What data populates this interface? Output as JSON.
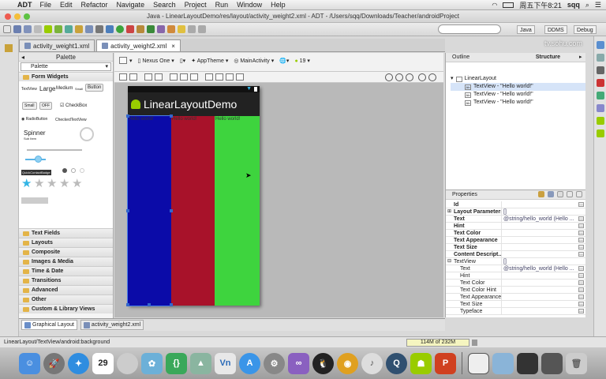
{
  "menubar": {
    "app": "ADT",
    "items": [
      "File",
      "Edit",
      "Refactor",
      "Navigate",
      "Search",
      "Project",
      "Run",
      "Window",
      "Help"
    ],
    "clock": "周五下午8:21",
    "user": "sqq"
  },
  "window": {
    "title": "Java - LinearLayoutDemo/res/layout/activity_weight2.xml - ADT - /Users/sqq/Downloads/Teacher/androidProject"
  },
  "perspectives": {
    "java": "Java",
    "ddms": "DDMS",
    "debug": "Debug"
  },
  "watermark": "tv.sohu.com",
  "editor_tabs": [
    {
      "label": "activity_weight1.xml"
    },
    {
      "label": "activity_weight2.xml"
    }
  ],
  "palette": {
    "title": "Palette",
    "dropdown": "Palette",
    "open_category": "Form Widgets",
    "widgets": {
      "textview": "TextView",
      "large": "Large",
      "medium": "Medium",
      "small": "Small",
      "button": "Button",
      "small_button": "Small",
      "toggle": "OFF",
      "checkbox": "CheckBox",
      "radio": "RadioButton",
      "checked_tv": "CheckedTextView",
      "spinner": "Spinner",
      "spinner_sub": "Sub Item",
      "quick_contact": "QuickContactBadge"
    },
    "categories": [
      "Text Fields",
      "Layouts",
      "Composite",
      "Images & Media",
      "Time & Date",
      "Transitions",
      "Advanced",
      "Other",
      "Custom & Library Views"
    ]
  },
  "layout_toolbar": {
    "device": "Nexus One",
    "theme": "AppTheme",
    "activity": "MainActivity",
    "api": "19"
  },
  "device": {
    "app_title": "LinearLayoutDemo",
    "columns": [
      {
        "text": "Hello world!",
        "color": "#0b0ba8"
      },
      {
        "text": "Hello world!",
        "color": "#a8122a"
      },
      {
        "text": "Hello world!",
        "color": "#3ed43e"
      }
    ]
  },
  "bottom_tabs": {
    "graphical": "Graphical Layout",
    "xml": "activity_weight2.xml"
  },
  "outline": {
    "title": "Outline",
    "structure": "Structure",
    "root": "LinearLayout",
    "children": [
      "TextView - \"Hello world!\"",
      "TextView - \"Hello world!\"",
      "TextView - \"Hello world!\""
    ]
  },
  "properties": {
    "title": "Properties",
    "rows": [
      {
        "key": "Id",
        "value": "",
        "sub": false
      },
      {
        "key": "Layout Parameters",
        "value": "[]",
        "sub": false
      },
      {
        "key": "Text",
        "value": "@string/hello_world (Hello ...",
        "sub": false
      },
      {
        "key": "Hint",
        "value": "",
        "sub": false
      },
      {
        "key": "Text Color",
        "value": "",
        "sub": false
      },
      {
        "key": "Text Appearance",
        "value": "",
        "sub": false
      },
      {
        "key": "Text Size",
        "value": "",
        "sub": false
      },
      {
        "key": "Content Descript...",
        "value": "",
        "sub": false
      },
      {
        "key": "TextView",
        "value": "[]",
        "sub": false
      },
      {
        "key": "Text",
        "value": "@string/hello_world (Hello ...",
        "sub": true
      },
      {
        "key": "Hint",
        "value": "",
        "sub": true
      },
      {
        "key": "Text Color",
        "value": "",
        "sub": true
      },
      {
        "key": "Text Color Hint",
        "value": "",
        "sub": true
      },
      {
        "key": "Text Appearance",
        "value": "",
        "sub": true
      },
      {
        "key": "Text Size",
        "value": "",
        "sub": true
      },
      {
        "key": "Typeface",
        "value": "",
        "sub": true
      }
    ]
  },
  "statusline": {
    "path": "LinearLayout/TextView/android:background",
    "heap": "114M of 232M"
  },
  "dock": {
    "calendar_day": "29"
  }
}
